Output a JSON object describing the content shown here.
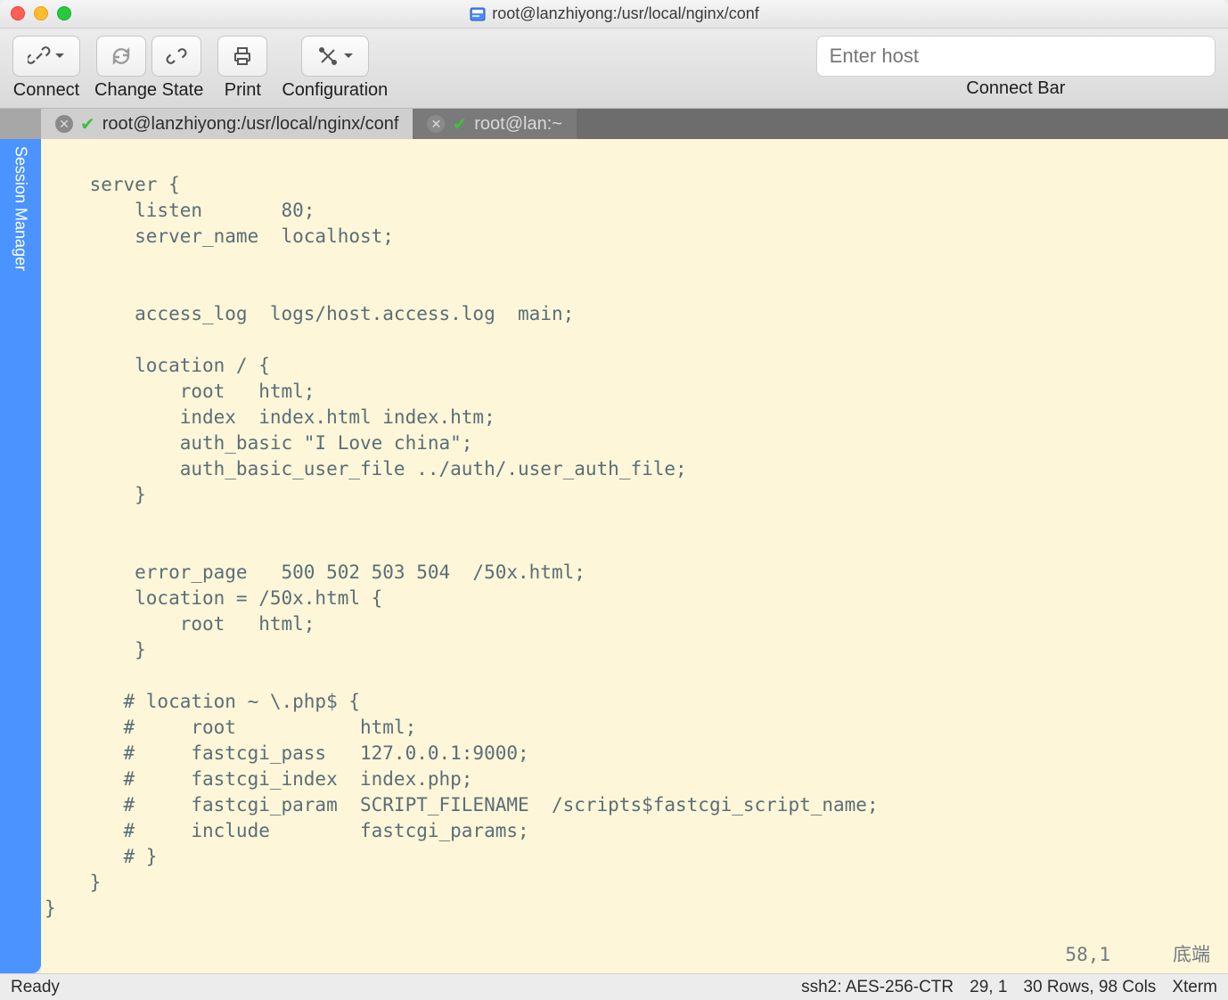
{
  "window": {
    "title": "root@lanzhiyong:/usr/local/nginx/conf"
  },
  "toolbar": {
    "connect_label": "Connect",
    "change_state_label": "Change State",
    "print_label": "Print",
    "config_label": "Configuration",
    "connect_bar_label": "Connect Bar",
    "host_placeholder": "Enter host"
  },
  "tabs": [
    {
      "label": "root@lanzhiyong:/usr/local/nginx/conf",
      "active": true
    },
    {
      "label": "root@lan:~",
      "active": false
    }
  ],
  "session_manager_label": "Session Manager",
  "terminal": {
    "lines": [
      "    server {",
      "        listen       80;",
      "        server_name  localhost;",
      "",
      "",
      "        access_log  logs/host.access.log  main;",
      "",
      "        location / {",
      "            root   html;",
      "            index  index.html index.htm;",
      "            auth_basic \"I Love china\";",
      "            auth_basic_user_file ../auth/.user_auth_file;",
      "        }",
      "",
      "",
      "        error_page   500 502 503 504  /50x.html;",
      "        location = /50x.html {",
      "            root   html;",
      "        }",
      "",
      "       # location ~ \\.php$ {",
      "       #     root           html;",
      "       #     fastcgi_pass   127.0.0.1:9000;",
      "       #     fastcgi_index  index.php;",
      "       #     fastcgi_param  SCRIPT_FILENAME  /scripts$fastcgi_script_name;",
      "       #     include        fastcgi_params;",
      "       # }",
      "    }",
      "}"
    ],
    "cursor_pos": "58,1",
    "scroll_hint": "底端"
  },
  "footer": {
    "status": "Ready",
    "encryption": "ssh2: AES-256-CTR",
    "position": "29, 1",
    "dimensions": "30 Rows, 98 Cols",
    "term_type": "Xterm"
  }
}
